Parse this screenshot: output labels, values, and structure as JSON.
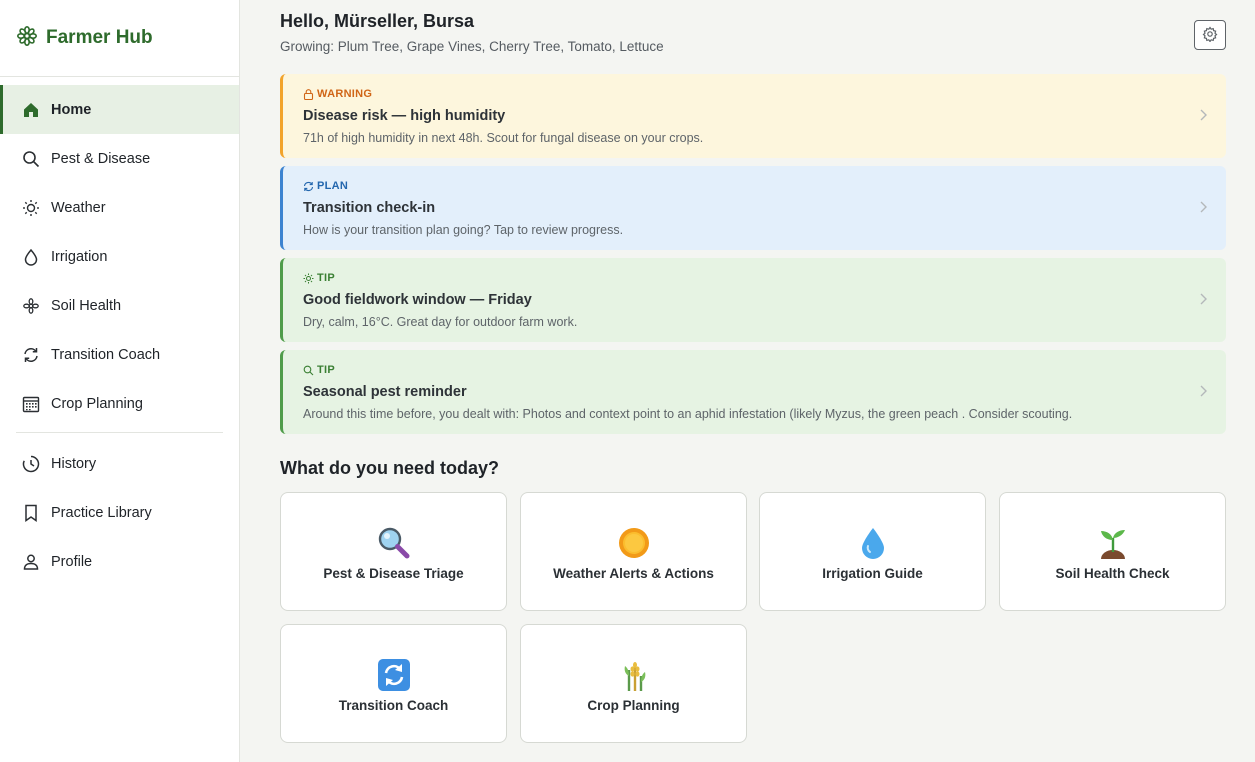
{
  "app": {
    "name": "Farmer Hub"
  },
  "sidebar": {
    "items": [
      {
        "label": "Home",
        "icon": "home-icon",
        "active": true
      },
      {
        "label": "Pest & Disease",
        "icon": "search-icon"
      },
      {
        "label": "Weather",
        "icon": "sun-icon"
      },
      {
        "label": "Irrigation",
        "icon": "droplet-icon"
      },
      {
        "label": "Soil Health",
        "icon": "flower-icon"
      },
      {
        "label": "Transition Coach",
        "icon": "refresh-icon"
      },
      {
        "label": "Crop Planning",
        "icon": "calendar-icon"
      }
    ],
    "secondary": [
      {
        "label": "History",
        "icon": "clock-icon"
      },
      {
        "label": "Practice Library",
        "icon": "bookmark-icon"
      },
      {
        "label": "Profile",
        "icon": "user-icon"
      }
    ]
  },
  "header": {
    "greeting": "Hello, Mürseller, Bursa",
    "growing": "Growing: Plum Tree, Grape Vines, Cherry Tree, Tomato, Lettuce"
  },
  "alerts": [
    {
      "type": "warning",
      "tag": "WARNING",
      "icon": "lock-icon",
      "title": "Disease risk — high humidity",
      "desc": "71h of high humidity in next 48h. Scout for fungal disease on your crops."
    },
    {
      "type": "plan",
      "tag": "PLAN",
      "icon": "refresh-icon",
      "title": "Transition check-in",
      "desc": "How is your transition plan going? Tap to review progress."
    },
    {
      "type": "tip",
      "tag": "TIP",
      "icon": "sun-icon",
      "title": "Good fieldwork window — Friday",
      "desc": "Dry, calm, 16°C. Great day for outdoor farm work."
    },
    {
      "type": "tip",
      "tag": "TIP",
      "icon": "search-icon",
      "title": "Seasonal pest reminder",
      "desc": "Around this time before, you dealt with: Photos and context point to an aphid infestation (likely Myzus, the green peach . Consider scouting."
    }
  ],
  "needs": {
    "title": "What do you need today?",
    "tiles": [
      {
        "label": "Pest & Disease Triage",
        "icon": "magnifier-icon"
      },
      {
        "label": "Weather Alerts & Actions",
        "icon": "sun-icon"
      },
      {
        "label": "Irrigation Guide",
        "icon": "droplet-icon"
      },
      {
        "label": "Soil Health Check",
        "icon": "seedling-icon"
      },
      {
        "label": "Transition Coach",
        "icon": "cycle-icon"
      },
      {
        "label": "Crop Planning",
        "icon": "crops-icon"
      }
    ]
  },
  "colors": {
    "brand": "#2e6b2c",
    "warning": "#f2a32a",
    "plan": "#3c83d0",
    "tip": "#4f9c4a"
  }
}
